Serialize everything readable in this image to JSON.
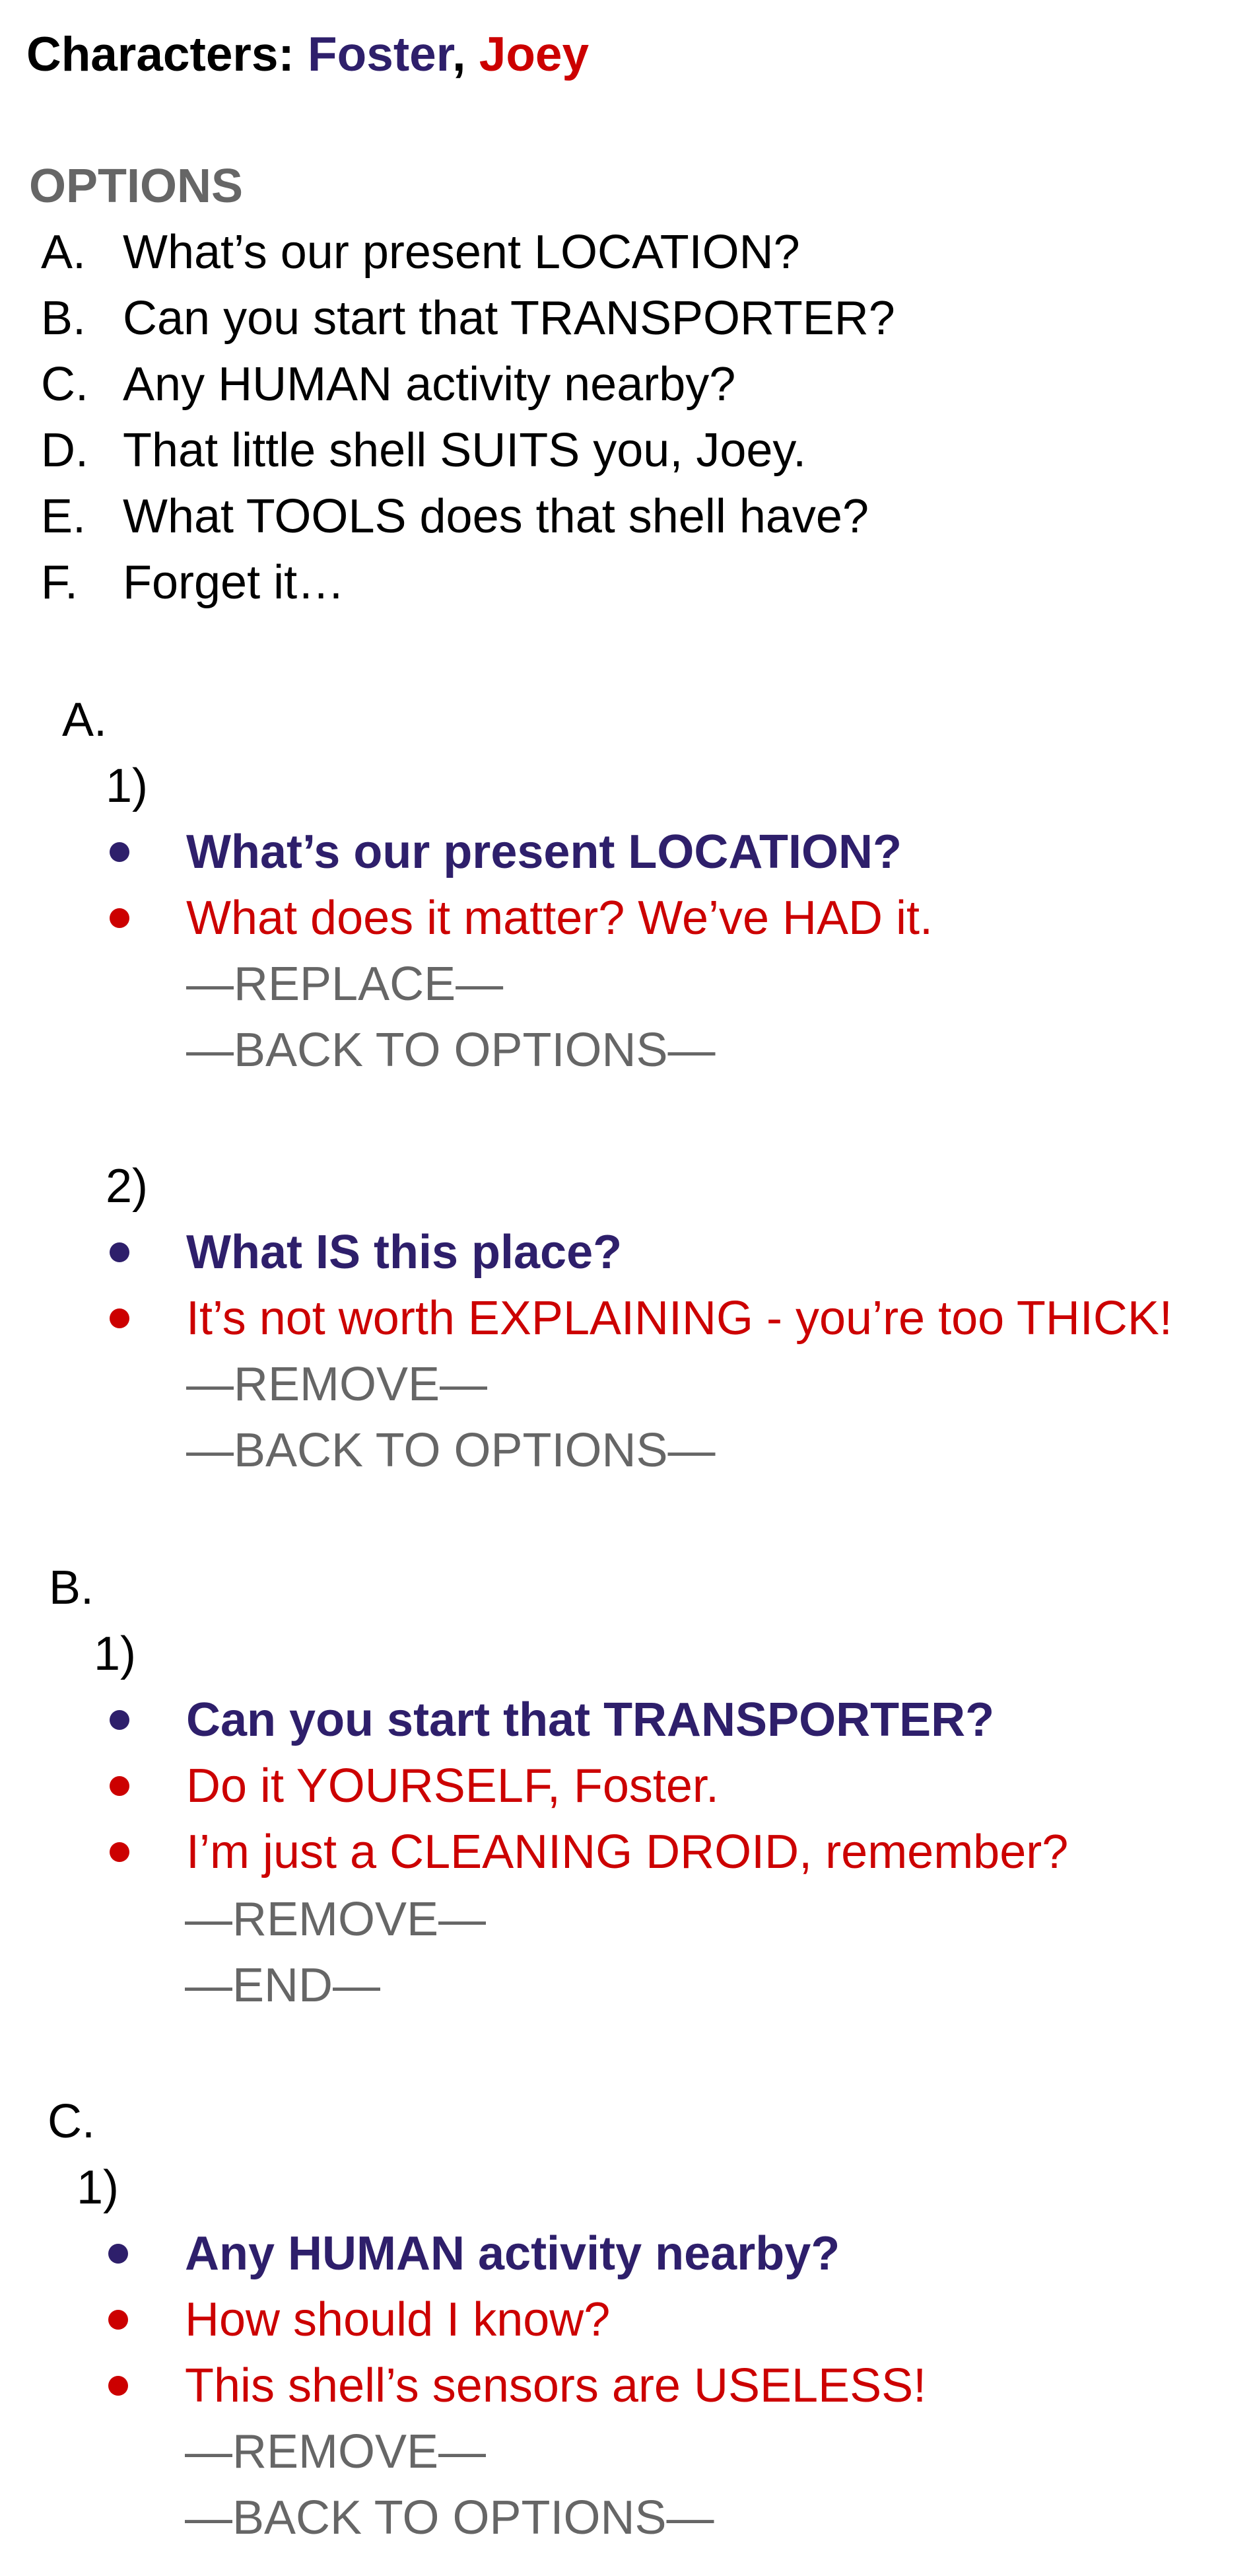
{
  "header": {
    "label": "Characters:",
    "foster": "Foster",
    "comma": ",",
    "joey": "Joey"
  },
  "options": {
    "heading": "OPTIONS",
    "items": [
      {
        "letter": "A.",
        "text": "What’s our present LOCATION?"
      },
      {
        "letter": "B.",
        "text": "Can you start that TRANSPORTER?"
      },
      {
        "letter": "C.",
        "text": "Any HUMAN activity nearby?"
      },
      {
        "letter": "D.",
        "text": "That little shell SUITS you, Joey."
      },
      {
        "letter": "E.",
        "text": "What TOOLS does that shell have?"
      },
      {
        "letter": "F.",
        "text": "Forget it…"
      }
    ]
  },
  "sections": {
    "a": {
      "letter": "A.",
      "d1": {
        "num": "1)",
        "foster_line": "What’s our present LOCATION?",
        "joey_line": "What does it matter? We’ve HAD it.",
        "directive1": "—REPLACE—",
        "directive2": "—BACK TO OPTIONS—"
      },
      "d2": {
        "num": "2)",
        "foster_line": "What IS this place?",
        "joey_line": "It’s not worth EXPLAINING - you’re too THICK!",
        "directive1": "—REMOVE—",
        "directive2": "—BACK TO OPTIONS—"
      }
    },
    "b": {
      "letter": "B.",
      "d1": {
        "num": "1)",
        "foster_line": "Can you start that TRANSPORTER?",
        "joey_line1": "Do it YOURSELF, Foster.",
        "joey_line2": "I’m just a CLEANING DROID, remember?",
        "directive1": "—REMOVE—",
        "directive2": "—END—"
      }
    },
    "c": {
      "letter": "C.",
      "d1": {
        "num": "1)",
        "foster_line": "Any HUMAN activity nearby?",
        "joey_line1": "How should I know?",
        "joey_line2": "This shell’s sensors are USELESS!",
        "directive1": "—REMOVE—",
        "directive2": "—BACK TO OPTIONS—"
      }
    }
  },
  "colors": {
    "foster": "#2e1f6b",
    "joey": "#cc0000",
    "directive": "#666666"
  }
}
